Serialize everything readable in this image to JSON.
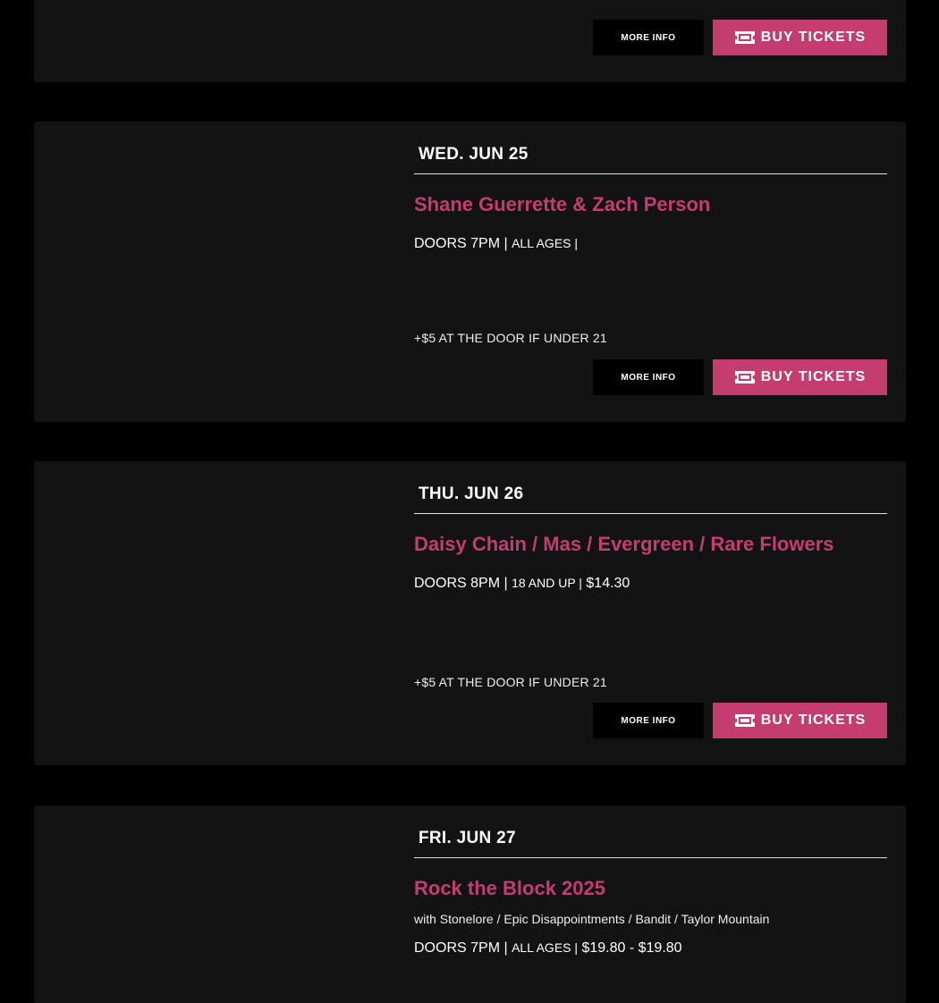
{
  "colors": {
    "accent": "#c43d6e",
    "card_bg": "#131313",
    "page_bg": "#000000"
  },
  "common": {
    "more_info_label": "MORE INFO",
    "buy_tickets_label": "BUY TICKETS",
    "ticket_icon": "ticket-icon"
  },
  "events": [
    {
      "more_info_label": "MORE INFO",
      "buy_tickets_label": "BUY TICKETS"
    },
    {
      "date": "WED. JUN 25",
      "title": "Shane Guerrette & Zach Person",
      "doors": "DOORS 7PM |",
      "age": "ALL AGES |",
      "price": "",
      "under21": "+$5 AT THE DOOR IF UNDER 21",
      "more_info_label": "MORE INFO",
      "buy_tickets_label": "BUY TICKETS"
    },
    {
      "date": "THU. JUN 26",
      "title": "Daisy Chain / Mas / Evergreen / Rare Flowers",
      "doors": "DOORS 8PM |",
      "age": "18 AND UP |",
      "price": "$14.30",
      "under21": "+$5 AT THE DOOR IF UNDER 21",
      "more_info_label": "MORE INFO",
      "buy_tickets_label": "BUY TICKETS"
    },
    {
      "date": "FRI. JUN 27",
      "title": "Rock the Block 2025",
      "support": "with Stonelore / Epic Disappointments / Bandit / Taylor Mountain",
      "doors": "DOORS 7PM |",
      "age": "ALL AGES |",
      "price": "$19.80 - $19.80"
    }
  ]
}
